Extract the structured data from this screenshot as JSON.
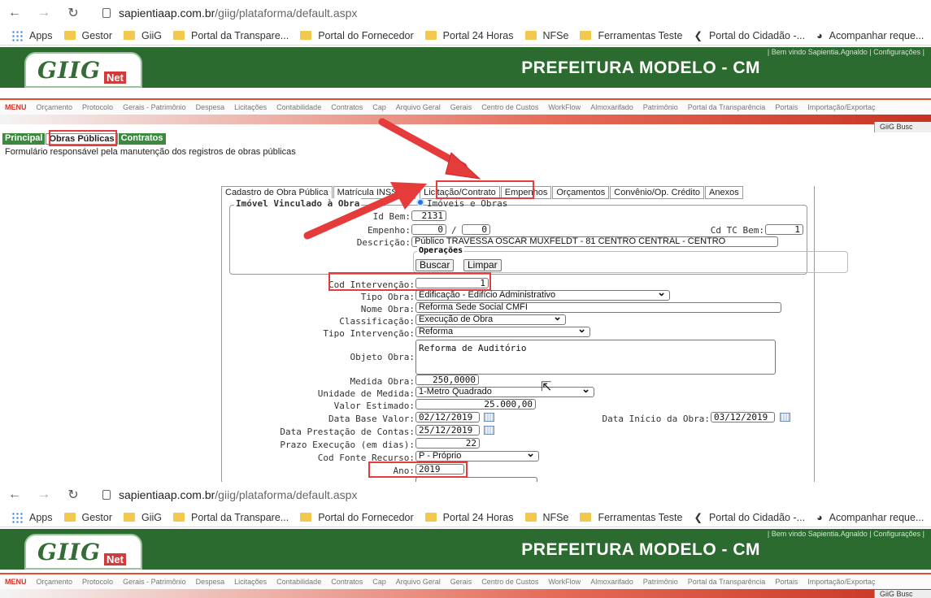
{
  "browser": {
    "url_host": "sapientiaap.com.br",
    "url_path": "/giig/plataforma/default.aspx",
    "bookmarks": [
      "Apps",
      "Gestor",
      "GiiG",
      "Portal da Transpare...",
      "Portal do Fornecedor",
      "Portal 24 Horas",
      "NFSe",
      "Ferramentas Teste",
      "Portal do Cidadão -...",
      "Acompanhar reque..."
    ]
  },
  "header": {
    "logo_text": "GIIG",
    "logo_badge": "Net",
    "title": "PREFEITURA MODELO - CM",
    "welcome": "| Bem vindo Sapientia.Agnaldo | Configurações |"
  },
  "menu": {
    "label": "MENU",
    "items": [
      "Orçamento",
      "Protocolo",
      "Gerais - Patrimônio",
      "Despesa",
      "Licitações",
      "Contabilidade",
      "Contratos",
      "Cap",
      "Arquivo Geral",
      "Gerais",
      "Centro de Custos",
      "WorkFlow",
      "Almoxarifado",
      "Patrimônio",
      "Portal da Transparência",
      "Portais",
      "Importação/Exportaç"
    ]
  },
  "search_label": "GiiG Busc",
  "top_tabs": [
    "Principal",
    "Obras Públicas",
    "Contratos"
  ],
  "description": "Formulário responsável pela manutenção dos registros de obras públicas",
  "form_tabs": [
    "Cadastro de Obra Pública",
    "Matrícula INSS/RT",
    "Licitação/Contrato",
    "Empenhos",
    "Orçamentos",
    "Convênio/Op. Crédito",
    "Anexos"
  ],
  "imovel": {
    "legend": "Imóvel Vinculado à Obra",
    "radio_label": "Imóveis e Obras",
    "id_bem_label": "Id Bem:",
    "id_bem": "2131",
    "empenho_label": "Empenho:",
    "empenho_1": "0",
    "empenho_sep": "/",
    "empenho_2": "0",
    "cd_tc_label": "Cd TC Bem:",
    "cd_tc": "1",
    "descricao_label": "Descrição:",
    "descricao": "Público TRAVESSA OSCAR MUXFELDT - 81 CENTRO CENTRAL - CENTRO",
    "ops_legend": "Operações",
    "buscar": "Buscar",
    "limpar": "Limpar"
  },
  "fields": {
    "cod_intervencao_label": "Cod Intervenção:",
    "cod_intervencao": "1",
    "tipo_obra_label": "Tipo Obra:",
    "tipo_obra": "Edificação - Edifício Administrativo",
    "nome_obra_label": "Nome Obra:",
    "nome_obra": "Reforma Sede Social CMFI",
    "classificacao_label": "Classificação:",
    "classificacao": "Execução de Obra",
    "tipo_intervencao_label": "Tipo Intervenção:",
    "tipo_intervencao": "Reforma",
    "objeto_obra_label": "Objeto Obra:",
    "objeto_obra": "Reforma de Auditório",
    "medida_obra_label": "Medida Obra:",
    "medida_obra": "250,0000",
    "unidade_medida_label": "Unidade de Medida:",
    "unidade_medida": "1-Metro Quadrado",
    "valor_estimado_label": "Valor Estimado:",
    "valor_estimado": "25.000,00",
    "data_base_label": "Data Base Valor:",
    "data_base": "02/12/2019",
    "data_inicio_label": "Data Início da Obra:",
    "data_inicio": "03/12/2019",
    "data_prestacao_label": "Data Prestação de Contas:",
    "data_prestacao": "25/12/2019",
    "prazo_label": "Prazo Execução (em dias):",
    "prazo": "22",
    "fonte_label": "Cod Fonte Recurso:",
    "fonte": "P - Próprio",
    "ano_label": "Ano:",
    "ano": "2019"
  },
  "colors": {
    "header_green": "#2c6b2f",
    "highlight_red": "#e53b3b",
    "arrow_red": "#e53b3b"
  }
}
